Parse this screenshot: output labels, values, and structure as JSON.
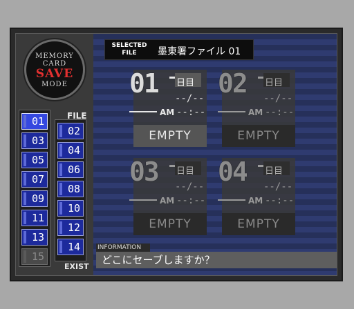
{
  "memory_card": {
    "line1": "MEMORY",
    "line2": "CARD",
    "line3": "SAVE",
    "line4": "MODE"
  },
  "file_label": "FILE",
  "exist_label": "EXIST",
  "slots_col1": [
    "01",
    "03",
    "05",
    "07",
    "09",
    "11",
    "13",
    "15"
  ],
  "slots_col2": [
    "02",
    "04",
    "06",
    "08",
    "10",
    "12",
    "14"
  ],
  "selected": {
    "label_line1": "SELECTED",
    "label_line2": "FILE",
    "name": "墨東署ファイル 01"
  },
  "cards": [
    {
      "number": "01",
      "day": "日目",
      "date": "--/--",
      "ampm": "AM",
      "time": "--:--",
      "status": "EMPTY"
    },
    {
      "number": "02",
      "day": "日目",
      "date": "--/--",
      "ampm": "AM",
      "time": "--:--",
      "status": "EMPTY"
    },
    {
      "number": "03",
      "day": "日目",
      "date": "--/--",
      "ampm": "AM",
      "time": "--:--",
      "status": "EMPTY"
    },
    {
      "number": "04",
      "day": "日目",
      "date": "--/--",
      "ampm": "AM",
      "time": "--:--",
      "status": "EMPTY"
    }
  ],
  "information": {
    "label": "INFORMATION",
    "message": "どこにセーブしますか？"
  },
  "colors": {
    "slot_blue": "#1d2a9c",
    "save_red": "#e23030",
    "stripe_dark": "#26305a",
    "stripe_light": "#2f3b70"
  }
}
